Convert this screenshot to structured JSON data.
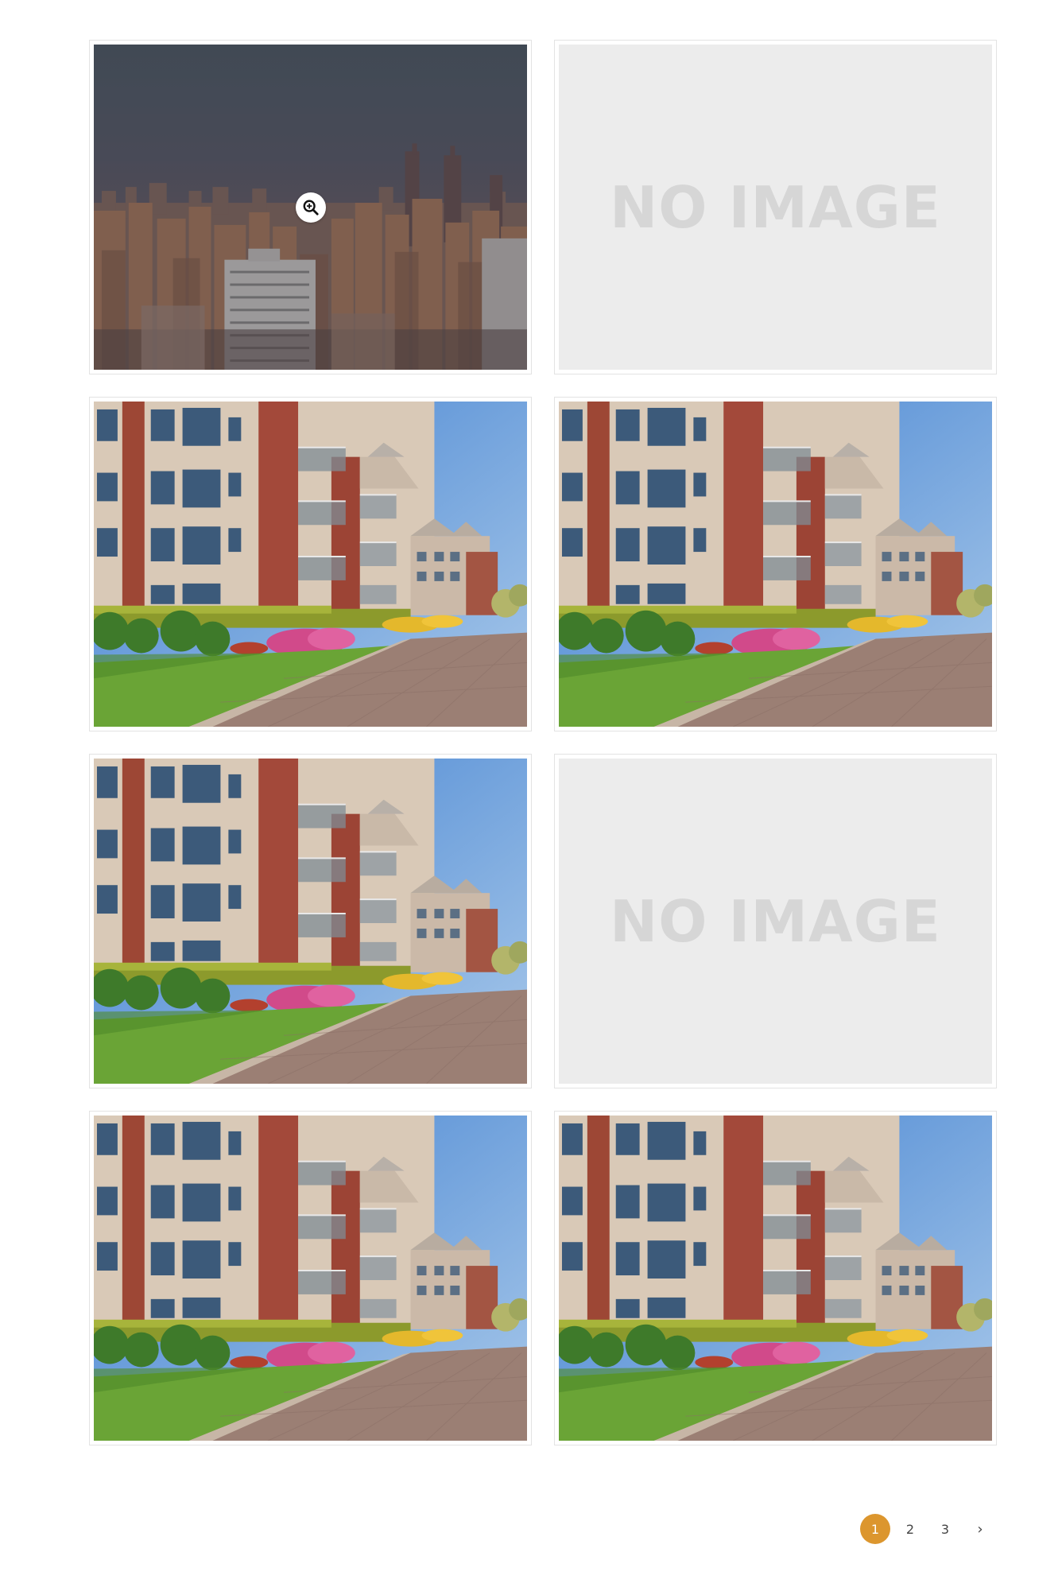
{
  "gallery": {
    "items": [
      {
        "kind": "photo",
        "scene": "city-skyline",
        "hovered": true,
        "zoom_icon": "zoom-in-icon"
      },
      {
        "kind": "placeholder",
        "text": "NO IMAGE"
      },
      {
        "kind": "photo",
        "scene": "apartment-building"
      },
      {
        "kind": "photo",
        "scene": "apartment-building"
      },
      {
        "kind": "photo",
        "scene": "apartment-building"
      },
      {
        "kind": "placeholder",
        "text": "NO IMAGE"
      },
      {
        "kind": "photo",
        "scene": "apartment-building"
      },
      {
        "kind": "photo",
        "scene": "apartment-building"
      }
    ]
  },
  "pagination": {
    "pages": [
      "1",
      "2",
      "3"
    ],
    "current": "1",
    "next_label": "›"
  },
  "colors": {
    "accent": "#dc962e",
    "placeholder_bg": "#ececec",
    "placeholder_text": "#d6d6d6",
    "card_border": "#e3e3e3"
  }
}
